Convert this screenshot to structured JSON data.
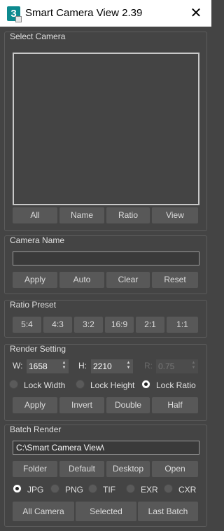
{
  "window": {
    "title": "Smart Camera View 2.39",
    "app_icon_text": "3",
    "close_symbol": "✕"
  },
  "select_camera": {
    "title": "Select Camera",
    "buttons": {
      "all": "All",
      "name": "Name",
      "ratio": "Ratio",
      "view": "View"
    }
  },
  "camera_name": {
    "title": "Camera Name",
    "value": "",
    "buttons": {
      "apply": "Apply",
      "auto": "Auto",
      "clear": "Clear",
      "reset": "Reset"
    }
  },
  "ratio_preset": {
    "title": "Ratio Preset",
    "presets": [
      "5:4",
      "4:3",
      "3:2",
      "16:9",
      "2:1",
      "1:1"
    ]
  },
  "render_setting": {
    "title": "Render Setting",
    "width_label": "W:",
    "width_value": "1658",
    "height_label": "H:",
    "height_value": "2210",
    "ratio_label": "R:",
    "ratio_value": "0.75",
    "lock_width": "Lock Width",
    "lock_height": "Lock Height",
    "lock_ratio": "Lock Ratio",
    "selected_lock": "Lock Ratio",
    "buttons": {
      "apply": "Apply",
      "invert": "Invert",
      "double": "Double",
      "half": "Half"
    }
  },
  "batch_render": {
    "title": "Batch Render",
    "path": "C:\\Smart Camera View\\",
    "buttons": {
      "folder": "Folder",
      "default": "Default",
      "desktop": "Desktop",
      "open": "Open"
    },
    "formats": [
      "JPG",
      "PNG",
      "TIF",
      "EXR",
      "CXR"
    ],
    "selected_format": "JPG",
    "actions": {
      "all_camera": "All Camera",
      "selected": "Selected",
      "last_batch": "Last Batch"
    }
  }
}
